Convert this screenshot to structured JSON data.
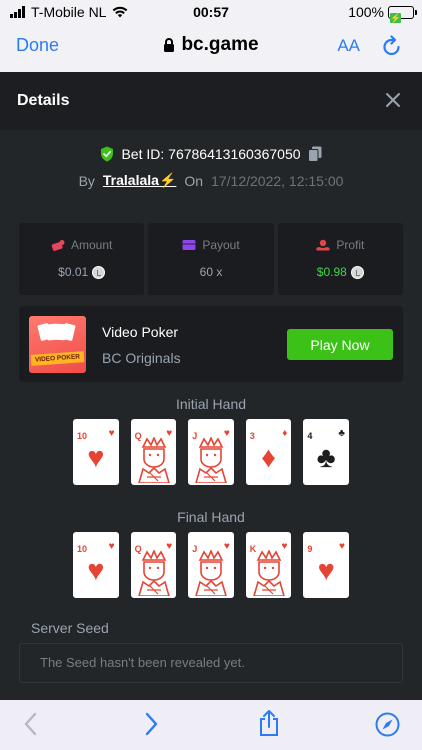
{
  "status_bar": {
    "carrier": "T-Mobile NL",
    "time": "00:57",
    "battery": "100%"
  },
  "browser": {
    "done_label": "Done",
    "address": "bc.game",
    "text_size_label": "AA"
  },
  "modal": {
    "title": "Details"
  },
  "bet": {
    "id_label": "Bet ID: 76786413160367050",
    "by_label": "By",
    "user": "Tralalala⚡",
    "on_label": "On",
    "date": "17/12/2022, 12:15:00"
  },
  "stats": {
    "amount": {
      "label": "Amount",
      "value": "$0.01"
    },
    "payout": {
      "label": "Payout",
      "value": "60 x"
    },
    "profit": {
      "label": "Profit",
      "value": "$0.98"
    }
  },
  "game": {
    "thumb_label": "VIDEO POKER",
    "name": "Video Poker",
    "provider": "BC Originals",
    "play_label": "Play Now"
  },
  "initial_hand": {
    "title": "Initial Hand",
    "cards": [
      {
        "rank": "10",
        "suit": "hearts"
      },
      {
        "rank": "Q",
        "suit": "hearts"
      },
      {
        "rank": "J",
        "suit": "hearts"
      },
      {
        "rank": "3",
        "suit": "diamonds"
      },
      {
        "rank": "4",
        "suit": "clubs"
      }
    ]
  },
  "final_hand": {
    "title": "Final Hand",
    "cards": [
      {
        "rank": "10",
        "suit": "hearts"
      },
      {
        "rank": "Q",
        "suit": "hearts"
      },
      {
        "rank": "J",
        "suit": "hearts"
      },
      {
        "rank": "K",
        "suit": "hearts"
      },
      {
        "rank": "9",
        "suit": "hearts"
      }
    ]
  },
  "server_seed": {
    "title": "Server Seed",
    "message": "The Seed hasn't been revealed yet."
  },
  "colors": {
    "accent_green": "#3bc117",
    "profit_green": "#42d645",
    "card_red": "#e54333",
    "safari_blue": "#2a7cf6"
  }
}
